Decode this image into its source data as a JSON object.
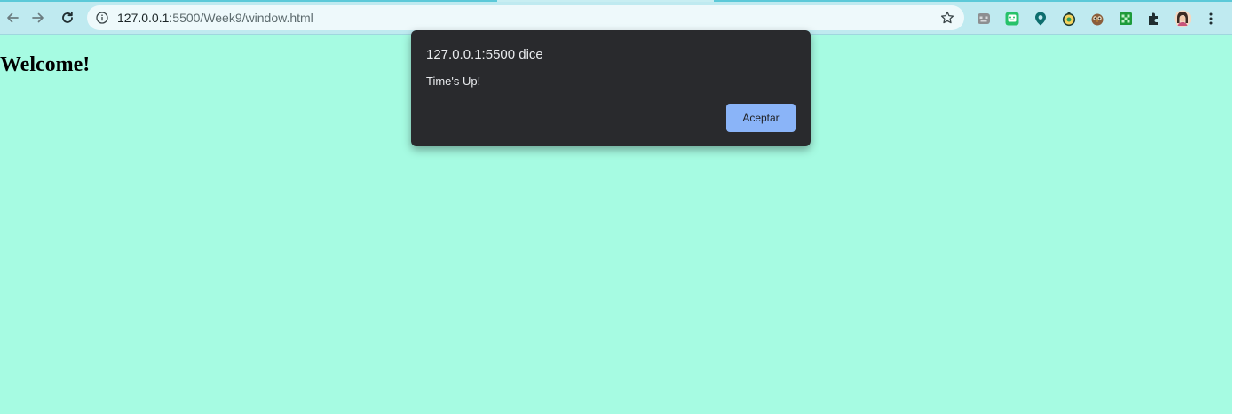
{
  "browser": {
    "url_host": "127.0.0.1",
    "url_rest": ":5500/Week9/window.html",
    "toolbar_icons": [
      "back-arrow-icon",
      "forward-arrow-icon",
      "reload-icon",
      "site-info-icon",
      "bookmark-star-icon"
    ],
    "extensions": [
      "robot-extension-icon",
      "green-face-extension-icon",
      "map-pin-extension-icon",
      "timer-extension-icon",
      "owl-extension-icon",
      "green-grid-extension-icon",
      "puzzle-extensions-icon",
      "profile-avatar",
      "kebab-menu-icon"
    ]
  },
  "page": {
    "heading": "Welcome!",
    "background": "#a6fbe2"
  },
  "dialog": {
    "title": "127.0.0.1:5500 dice",
    "message": "Time's Up!",
    "ok_label": "Aceptar",
    "button_color": "#8ab4f8",
    "background": "#292a2d"
  }
}
